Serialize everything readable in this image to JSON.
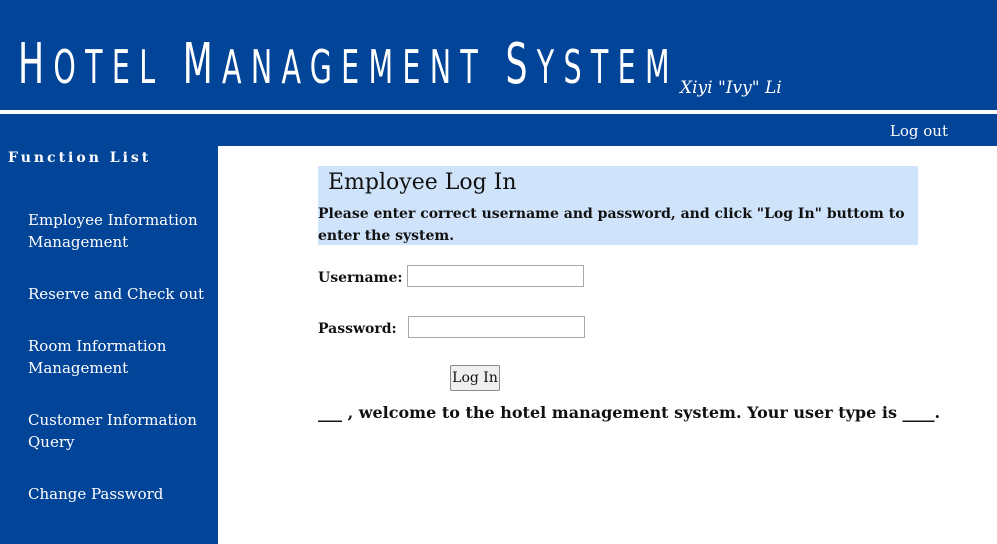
{
  "header": {
    "title": "Hotel Management System",
    "author": "Xiyi \"Ivy\" Li"
  },
  "topbar": {
    "logout_label": "Log out"
  },
  "sidebar": {
    "title": "Function List",
    "items": [
      {
        "label": "Employee Information Management"
      },
      {
        "label": "Reserve and Check out"
      },
      {
        "label": "Room Information Management"
      },
      {
        "label": "Customer Information Query"
      },
      {
        "label": "Change Password"
      }
    ]
  },
  "login": {
    "title": "Employee Log In",
    "description": "Please enter correct username and password, and click \"Log In\" buttom to enter the system.",
    "username_label": "Username:",
    "username_value": "",
    "password_label": "Password:",
    "password_value": "",
    "button_label": "Log In"
  },
  "welcome_text": "___ , welcome to the hotel management system. Your user type is ____.",
  "colors": {
    "brand": "#024497",
    "panel": "#cfe3fa"
  }
}
